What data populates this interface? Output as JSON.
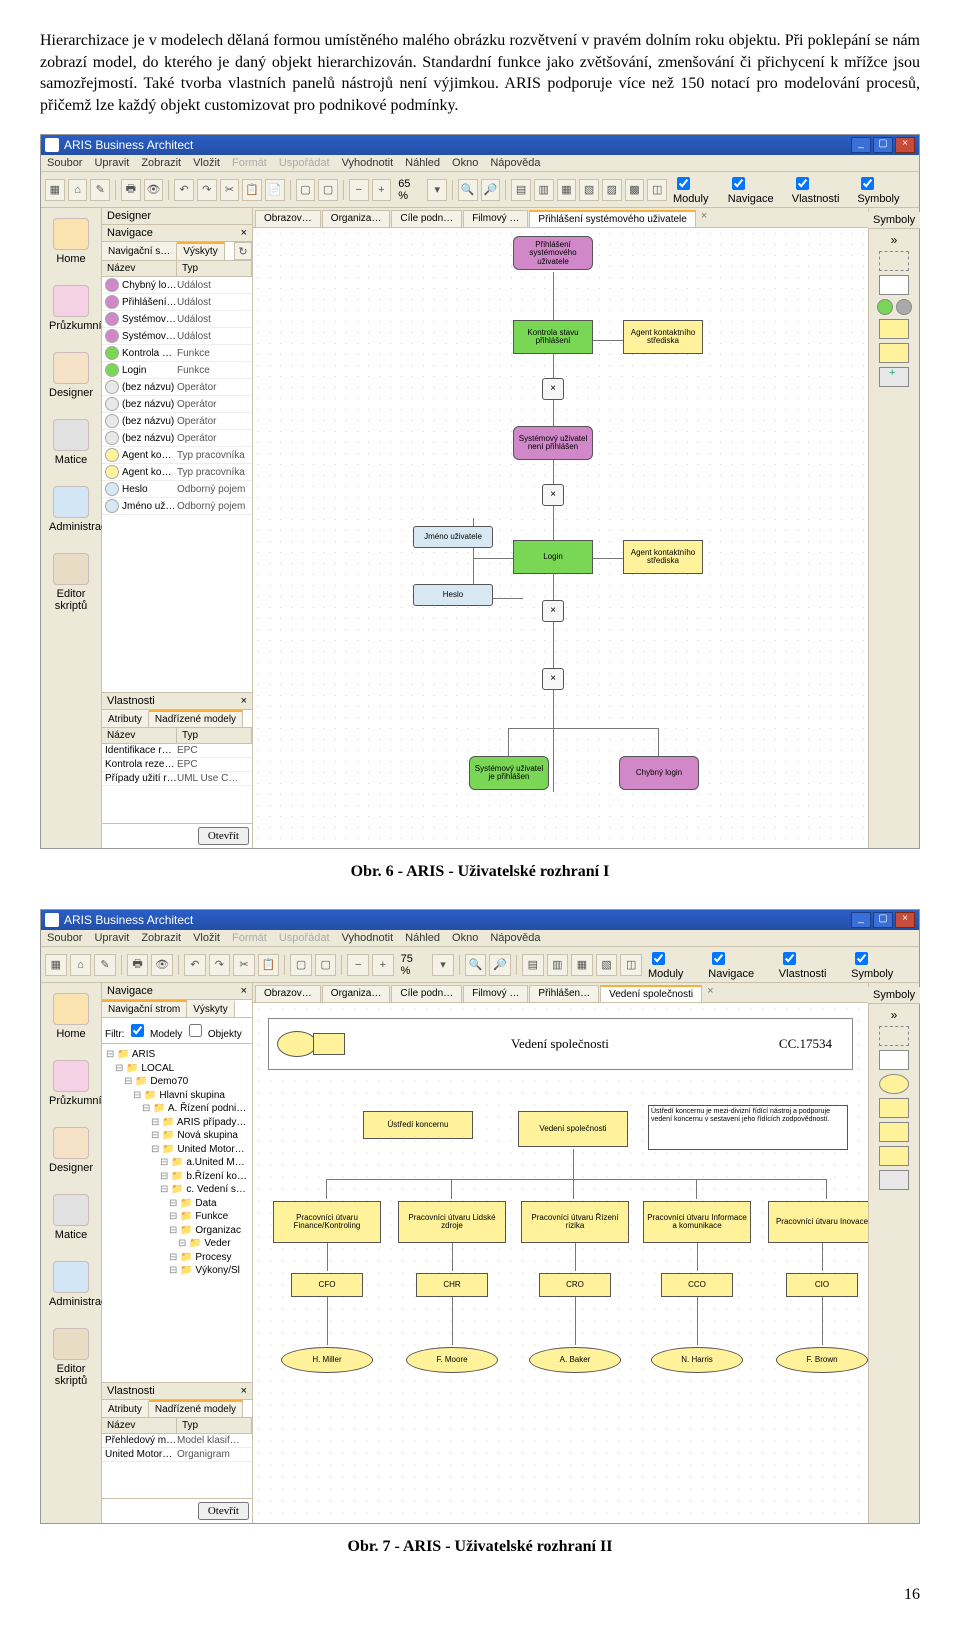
{
  "para": "Hierarchizace je v modelech dělaná formou umístěného malého obrázku rozvětvení v pravém dolním roku objektu. Při poklepání se nám zobrazí model, do kterého je daný objekt hierarchizován. Standardní funkce jako zvětšování, zmenšování či přichycení k mřížce jsou samozřejmostí. Také tvorba vlastních panelů nástrojů není výjimkou. ARIS podporuje více než 150 notací pro modelování procesů, přičemž lze každý objekt customizovat pro podnikové podmínky.",
  "app_title": "ARIS Business Architect",
  "menu": [
    "Soubor",
    "Upravit",
    "Zobrazit",
    "Vložit",
    "Formát",
    "Uspořádat",
    "Vyhodnotit",
    "Náhled",
    "Okno",
    "Nápověda"
  ],
  "zoom1": "65 %",
  "zoom2": "75 %",
  "right_checks": [
    "Moduly",
    "Navigace",
    "Vlastnosti",
    "Symboly"
  ],
  "side_items": [
    "Home",
    "Průzkumník",
    "Designer",
    "Matice",
    "Administrace",
    "Editor skriptů"
  ],
  "nav_title": "Navigace",
  "designer_title": "Designer",
  "nav_tabs1": [
    "Navigační s…",
    "Výskyty"
  ],
  "list_head": [
    "Název",
    "Typ"
  ],
  "fig1_list": [
    [
      "Chybný lo…",
      "Událost",
      "#d088c8"
    ],
    [
      "Přihlášení …",
      "Událost",
      "#d088c8"
    ],
    [
      "Systémov…",
      "Událost",
      "#d088c8"
    ],
    [
      "Systémov…",
      "Událost",
      "#d088c8"
    ],
    [
      "Kontrola st…",
      "Funkce",
      "#7ad756"
    ],
    [
      "Login",
      "Funkce",
      "#7ad756"
    ],
    [
      "(bez názvu)",
      "Operátor",
      "#e8e8e8"
    ],
    [
      "(bez názvu)",
      "Operátor",
      "#e8e8e8"
    ],
    [
      "(bez názvu)",
      "Operátor",
      "#e8e8e8"
    ],
    [
      "(bez názvu)",
      "Operátor",
      "#e8e8e8"
    ],
    [
      "Agent kont…",
      "Typ pracovníka",
      "#fff29a"
    ],
    [
      "Agent kont…",
      "Typ pracovníka",
      "#fff29a"
    ],
    [
      "Heslo",
      "Odborný pojem",
      "#d7e8f3"
    ],
    [
      "Jméno uži…",
      "Odborný pojem",
      "#d7e8f3"
    ]
  ],
  "props_title": "Vlastnosti",
  "props_tabs": [
    "Atributy",
    "Nadřízené modely"
  ],
  "fig1_props": [
    [
      "Identifikace reze…",
      "EPC"
    ],
    [
      "Kontrola rezerv…",
      "EPC"
    ],
    [
      "Případy užití re…",
      "UML Use C…"
    ]
  ],
  "fig2_props": [
    [
      "Přehledový mod…",
      "Model klasif…"
    ],
    [
      "United Motors G…",
      "Organigram"
    ]
  ],
  "open_btn": "Otevřít",
  "canvas_tabs1": [
    "Obrazov…",
    "Organiza…",
    "Cíle podn…",
    "Filmový …",
    "Přihlášení systémového uživatele"
  ],
  "canvas_tabs2": [
    "Obrazov…",
    "Organiza…",
    "Cíle podn…",
    "Filmový …",
    "Přihlášen…",
    "Vedení společnosti"
  ],
  "fig1_nodes": {
    "n1": "Přihlášení systémového uživatele",
    "n2": "Kontrola stavu přihlášení",
    "n3": "Agent kontaktního střediska",
    "n4": "Systémový uživatel není přihlášen",
    "n5": "Jméno uživatele",
    "n6": "Heslo",
    "n7": "Login",
    "n8": "Agent kontaktního střediska",
    "n9": "Systémový uživatel je přihlášen",
    "n10": "Chybný login"
  },
  "fig2_filter": "Filtr:",
  "fig2_filter_opts": [
    "Modely",
    "Objekty"
  ],
  "nav_tabs2": [
    "Navigační strom",
    "Výskyty"
  ],
  "fig2_tree": [
    [
      "ARIS",
      0
    ],
    [
      "LOCAL",
      1
    ],
    [
      "Demo70",
      2
    ],
    [
      "Hlavní skupina",
      3
    ],
    [
      "A. Řízení podnikových p",
      4
    ],
    [
      "ARIS případy užití",
      5
    ],
    [
      "Nová skupina",
      5
    ],
    [
      "United Motors Grou",
      5
    ],
    [
      "a.United Motor",
      6
    ],
    [
      "b.Řízení konce",
      6
    ],
    [
      "c. Vedení spole",
      6
    ],
    [
      "Data",
      7
    ],
    [
      "Funkce",
      7
    ],
    [
      "Organizac",
      7
    ],
    [
      "Veder",
      8
    ],
    [
      "Procesy",
      7
    ],
    [
      "Výkony/Sl",
      7
    ]
  ],
  "fig2_header_title": "Vedení společnosti",
  "fig2_header_code": "CC.17534",
  "fig2_nodes": {
    "top": "Ústředí koncernu",
    "mid": "Vedení společnosti",
    "note": "Ústředí koncernu je mezi-divizní řídící nástroj a podporuje vedení koncernu v sestavení jeho řídících zodpovědností.",
    "depts": [
      "Pracovníci útvaru Finance/Kontroling",
      "Pracovníci útvaru Lidské zdroje",
      "Pracovníci útvaru Řízení rizika",
      "Pracovníci útvaru Informace a komunikace",
      "Pracovníci útvaru Inovace"
    ],
    "roles": [
      "CFO",
      "CHR",
      "CRO",
      "CCO",
      "CIO"
    ],
    "people": [
      "H. Miller",
      "F. Moore",
      "A. Baker",
      "N. Harris",
      "F. Brown"
    ]
  },
  "symbols_title": "Symboly",
  "caption1": "Obr. 6 - ARIS - Uživatelské rozhraní I",
  "caption2": "Obr. 7 - ARIS - Uživatelské rozhraní II",
  "page_num": "16"
}
